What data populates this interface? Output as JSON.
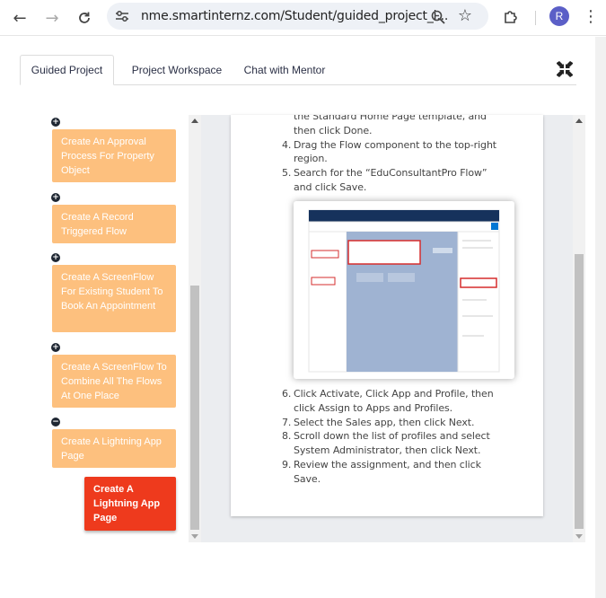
{
  "browser": {
    "url": "nme.smartinternz.com/Student/guided_project_i...",
    "profile_initial": "R"
  },
  "tabs": [
    {
      "label": "Guided Project",
      "active": true
    },
    {
      "label": "Project Workspace",
      "active": false
    },
    {
      "label": "Chat with Mentor",
      "active": false
    }
  ],
  "steps": [
    {
      "label": "Create An Approval Process For Property Object",
      "toggle": "+"
    },
    {
      "label": "Create A Record Triggered Flow",
      "toggle": "+"
    },
    {
      "label": "Create A ScreenFlow For Existing Student To Book An Appointment",
      "toggle": "+"
    },
    {
      "label": "Create A ScreenFlow To Combine All The Flows At One Place",
      "toggle": "+"
    },
    {
      "label": "Create A Lightning App Page",
      "toggle": "−"
    }
  ],
  "active_substep": {
    "label": "Create A Lightning App Page"
  },
  "doc": {
    "lines_top": [
      {
        "num": "",
        "text": "the Standard Home Page template, and"
      },
      {
        "num": "",
        "text": "then click Done."
      },
      {
        "num": "4.",
        "text": "Drag the Flow component to the top-right"
      },
      {
        "num": "",
        "text": "region."
      },
      {
        "num": "5.",
        "text": "Search for the “EduConsultantPro Flow”"
      },
      {
        "num": "",
        "text": "and click Save."
      }
    ],
    "lines_bottom": [
      {
        "num": "6.",
        "text": "Click Activate, Click App and Profile, then"
      },
      {
        "num": "",
        "text": "click Assign to Apps and Profiles."
      },
      {
        "num": "7.",
        "text": "Select the Sales app, then click Next."
      },
      {
        "num": "8.",
        "text": "Scroll down the list of profiles and select"
      },
      {
        "num": "",
        "text": "System Administrator, then click Next."
      },
      {
        "num": "9.",
        "text": "Review the assignment, and then click"
      },
      {
        "num": "",
        "text": "Save."
      }
    ]
  },
  "colors": {
    "step_card": "#fdc07e",
    "active_step": "#ee3a1d",
    "avatar": "#5b5fc7"
  }
}
